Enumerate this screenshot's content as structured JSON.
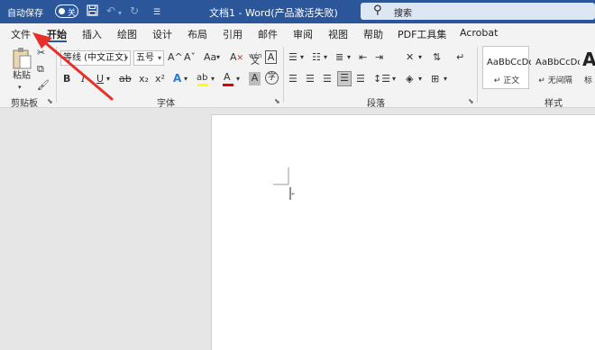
{
  "title_bar": {
    "autosave_label": "自动保存",
    "autosave_state": "关",
    "doc_title": "文档1 - Word(产品激活失败)",
    "search_placeholder": "搜索",
    "icons": [
      "save-icon",
      "undo-icon",
      "redo-icon",
      "customize-qat-icon",
      "search-icon"
    ]
  },
  "tabs": [
    "文件",
    "开始",
    "插入",
    "绘图",
    "设计",
    "布局",
    "引用",
    "邮件",
    "审阅",
    "视图",
    "帮助",
    "PDF工具集",
    "Acrobat"
  ],
  "active_tab": "开始",
  "ribbon": {
    "clipboard": {
      "paste_label": "粘贴",
      "group_label": "剪贴板",
      "icons": [
        "paste-icon",
        "cut-icon",
        "copy-icon",
        "format-painter-icon"
      ]
    },
    "font": {
      "font_name": "等线 (中文正文)",
      "font_size": "五号",
      "grow_label": "A^",
      "shrink_label": "Aˇ",
      "case_label": "Aa",
      "clear_label": "A",
      "phonetic_label": "wén",
      "border_label": "A",
      "bold_label": "B",
      "italic_label": "I",
      "underline_label": "U",
      "strike_label": "ab",
      "sub_label": "x₂",
      "sup_label": "x²",
      "effect_label": "A",
      "highlight_label": "ab",
      "color_label": "A",
      "shade_label": "A",
      "enclose_label": "字",
      "group_label": "字体"
    },
    "paragraph": {
      "group_label": "段落",
      "icons": [
        "bullets-icon",
        "numbering-icon",
        "multilevel-list-icon",
        "decrease-indent-icon",
        "increase-indent-icon",
        "chinese-layout-icon",
        "sort-icon",
        "show-marks-icon",
        "align-left-icon",
        "center-icon",
        "align-right-icon",
        "justify-icon",
        "distributed-icon",
        "line-spacing-icon",
        "shading-icon",
        "borders-icon"
      ]
    },
    "styles": {
      "group_label": "样式",
      "items": [
        {
          "sample": "AaBbCcDd",
          "name": "↵ 正文"
        },
        {
          "sample": "AaBbCcDd",
          "name": "↵ 无间隔"
        },
        {
          "sample": "A",
          "name": "标"
        }
      ]
    }
  },
  "colors": {
    "title_bar": "#2b579a",
    "ribbon": "#f3f3f3",
    "highlight": "#ffff00",
    "font_color": "#e00000",
    "annotation_arrow": "#e8302a"
  }
}
